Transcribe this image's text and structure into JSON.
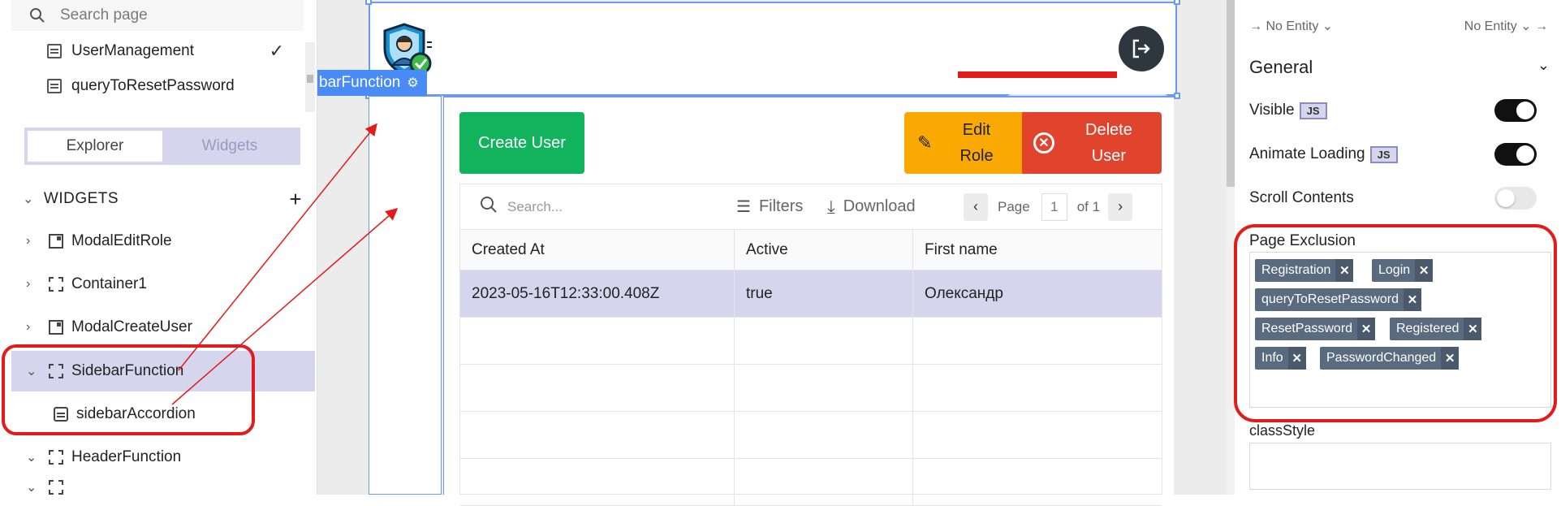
{
  "explorer": {
    "search_placeholder": "Search page",
    "pages": [
      {
        "label": "UserManagement",
        "selected": true
      },
      {
        "label": "queryToResetPassword",
        "selected": false
      }
    ],
    "tabs": [
      "Explorer",
      "Widgets"
    ],
    "active_tab": "Explorer",
    "widgets_header": "WIDGETS",
    "widgets": [
      {
        "label": "ModalEditRole",
        "icon": "modal-icon",
        "expanded": false
      },
      {
        "label": "Container1",
        "icon": "container-icon",
        "expanded": false
      },
      {
        "label": "ModalCreateUser",
        "icon": "modal-icon",
        "expanded": false
      },
      {
        "label": "SidebarFunction",
        "icon": "container-icon",
        "expanded": true,
        "selected": true
      },
      {
        "label": "sidebarAccordion",
        "icon": "accordion-icon",
        "child": true
      },
      {
        "label": "HeaderFunction",
        "icon": "container-icon",
        "expanded": true
      }
    ]
  },
  "canvas": {
    "selected_widget_label": "barFunction",
    "buttons": {
      "create_user": "Create User",
      "edit_role_line1": "Edit",
      "edit_role_line2": "Role",
      "delete_user_line1": "Delete",
      "delete_user_line2": "User"
    },
    "table": {
      "search_placeholder": "Search...",
      "filters_label": "Filters",
      "download_label": "Download",
      "page_label": "Page",
      "page_value": "1",
      "page_of": "of 1",
      "columns": [
        "Created At",
        "Active",
        "First name"
      ],
      "rows": [
        [
          "2023-05-16T12:33:00.408Z",
          "true",
          "Олександр"
        ]
      ]
    }
  },
  "properties": {
    "entity_left": "→ No Entity ⌄",
    "entity_right": "No Entity ⌄ →",
    "section_title": "General",
    "props": [
      {
        "label": "Visible",
        "js": "JS",
        "on": true
      },
      {
        "label": "Animate Loading",
        "js": "JS",
        "on": true
      },
      {
        "label": "Scroll Contents",
        "on": false
      }
    ],
    "page_exclusion_label": "Page Exclusion",
    "page_exclusion": [
      "Registration",
      "Login",
      "queryToResetPassword",
      "ResetPassword",
      "Registered",
      "Info",
      "PasswordChanged"
    ],
    "class_style_label": "classStyle"
  },
  "colors": {
    "accent": "#4a8cf7",
    "selection": "#d6d5ee",
    "create": "#11b35c",
    "edit": "#f9a902",
    "delete": "#e0442c",
    "annotation": "#e31b1b"
  }
}
